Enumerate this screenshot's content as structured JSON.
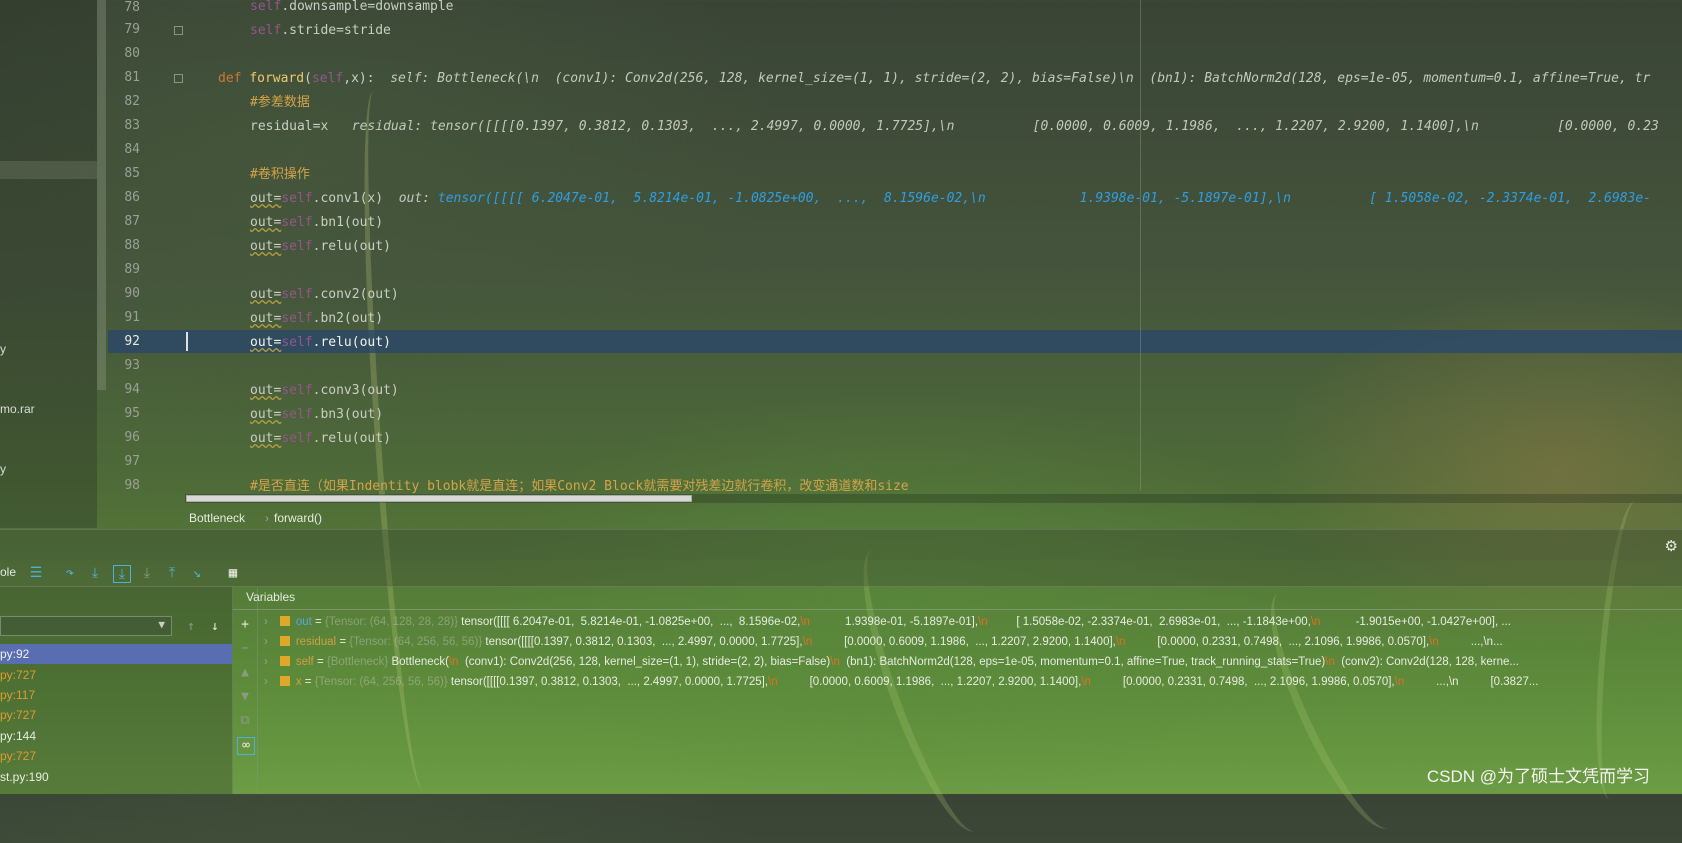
{
  "project_panel": {
    "items": [
      "y",
      "mo.rar",
      "y"
    ]
  },
  "editor": {
    "line_numbers": [
      "78",
      "79",
      "80",
      "81",
      "82",
      "83",
      "84",
      "85",
      "86",
      "87",
      "88",
      "89",
      "90",
      "91",
      "92",
      "93",
      "94",
      "95",
      "96",
      "97",
      "98"
    ],
    "current_line": "92",
    "lines": {
      "l78_a": "self",
      "l78_b": ".downsample=downsample",
      "l79_a": "self",
      "l79_b": ".stride=stride",
      "l81_def": "def ",
      "l81_fn": "forward",
      "l81_p1": "(",
      "l81_self": "self",
      "l81_p2": ",x):",
      "l81_hint": "  self: Bottleneck(\\n  (conv1): Conv2d(256, 128, kernel_size=(1, 1), stride=(2, 2), bias=False)\\n  (bn1): BatchNorm2d(128, eps=1e-05, momentum=0.1, affine=True, tr",
      "l82": "#参差数据",
      "l83_code": "residual=x",
      "l83_hint": "   residual: tensor([[[[0.1397, 0.3812, 0.1303,  ..., 2.4997, 0.0000, 1.7725],\\n          [0.0000, 0.6009, 1.1986,  ..., 1.2207, 2.9200, 1.1400],\\n          [0.0000, 0.23",
      "l85": "#卷积操作",
      "l86_a": "out=",
      "l86_self": "self",
      "l86_b": ".conv1(x)",
      "l86_hint_a": "  out: ",
      "l86_hint_b": "tensor([[[[ 6.2047e-01,  5.8214e-01, -1.0825e+00,  ...,  8.1596e-02,\\n            1.9398e-01, -5.1897e-01],\\n          [ 1.5058e-02, -2.3374e-01,  2.6983e-",
      "l87_b": ".bn1(out)",
      "l88_b": ".relu(out)",
      "l90_b": ".conv2(out)",
      "l91_b": ".bn2(out)",
      "l92_b": ".relu(out)",
      "l94_b": ".conv3(out)",
      "l95_b": ".bn3(out)",
      "l96_b": ".relu(out)",
      "l98": "#是否直连（如果Indentity blobk就是直连；如果Conv2 Block就需要对残差边就行卷积，改变通道数和size"
    },
    "kw_out": "out=",
    "kw_self": "self"
  },
  "breadcrumb": {
    "class": "Bottleneck",
    "sep": "›",
    "method": "forward()"
  },
  "debug": {
    "tab_label": "ole",
    "variables_title": "Variables",
    "frames": [
      {
        "label": "py:92",
        "selected": true,
        "color": "#f0f0f0"
      },
      {
        "label": "py:727",
        "selected": false,
        "color": "#e09a30"
      },
      {
        "label": "py:117",
        "selected": false,
        "color": "#e09a30"
      },
      {
        "label": "py:727",
        "selected": false,
        "color": "#e09a30"
      },
      {
        "label": "py:144",
        "selected": false,
        "color": "#e8ece2"
      },
      {
        "label": "py:727",
        "selected": false,
        "color": "#e09a30"
      },
      {
        "label": "st.py:190",
        "selected": false,
        "color": "#e8ece2"
      }
    ],
    "variables": [
      {
        "name": "out",
        "eq": " = ",
        "type": "{Tensor: (64, 128, 28, 28)} ",
        "value": "tensor([[[[ 6.2047e-01,  5.8214e-01, -1.0825e+00,  ...,  8.1596e-02,",
        "nl1": "\\n",
        "v2": "           1.9398e-01, -5.1897e-01],",
        "nl2": "\\n",
        "v3": "         [ 1.5058e-02, -2.3374e-01,  2.6983e-01,  ..., -1.1843e+00,",
        "nl3": "\\n",
        "v4": "           -1.9015e+00, -1.0427e+00], ..."
      },
      {
        "name": "residual",
        "eq": " = ",
        "type": "{Tensor: (64, 256, 56, 56)} ",
        "value": "tensor([[[[0.1397, 0.3812, 0.1303,  ..., 2.4997, 0.0000, 1.7725],",
        "nl1": "\\n",
        "v2": "          [0.0000, 0.6009, 1.1986,  ..., 1.2207, 2.9200, 1.1400],",
        "nl2": "\\n",
        "v3": "          [0.0000, 0.2331, 0.7498,  ..., 2.1096, 1.9986, 0.0570],",
        "nl3": "\\n",
        "v4": "          ...,\\n..."
      },
      {
        "name": "self",
        "eq": " = ",
        "type": "{Bottleneck} ",
        "value": "Bottleneck(",
        "nl1": "\\n",
        "v2": "  (conv1): Conv2d(256, 128, kernel_size=(1, 1), stride=(2, 2), bias=False)",
        "nl2": "\\n",
        "v3": "  (bn1): BatchNorm2d(128, eps=1e-05, momentum=0.1, affine=True, track_running_stats=True)",
        "nl3": "\\n",
        "v4": "  (conv2): Conv2d(128, 128, kerne..."
      },
      {
        "name": "x",
        "eq": " = ",
        "type": "{Tensor: (64, 256, 56, 56)} ",
        "value": "tensor([[[[0.1397, 0.3812, 0.1303,  ..., 2.4997, 0.0000, 1.7725],",
        "nl1": "\\n",
        "v2": "          [0.0000, 0.6009, 1.1986,  ..., 1.2207, 2.9200, 1.1400],",
        "nl2": "\\n",
        "v3": "          [0.0000, 0.2331, 0.7498,  ..., 2.1096, 1.9986, 0.0570],",
        "nl3": "\\n",
        "v4": "          ...,\\n          [0.3827..."
      }
    ]
  },
  "watermark": "CSDN @为了硕士文凭而学习",
  "icons": {
    "settings": "gear-icon",
    "add": "plus-icon",
    "up": "arrow-up-icon",
    "down": "arrow-down-icon",
    "watches": "glasses-icon"
  }
}
